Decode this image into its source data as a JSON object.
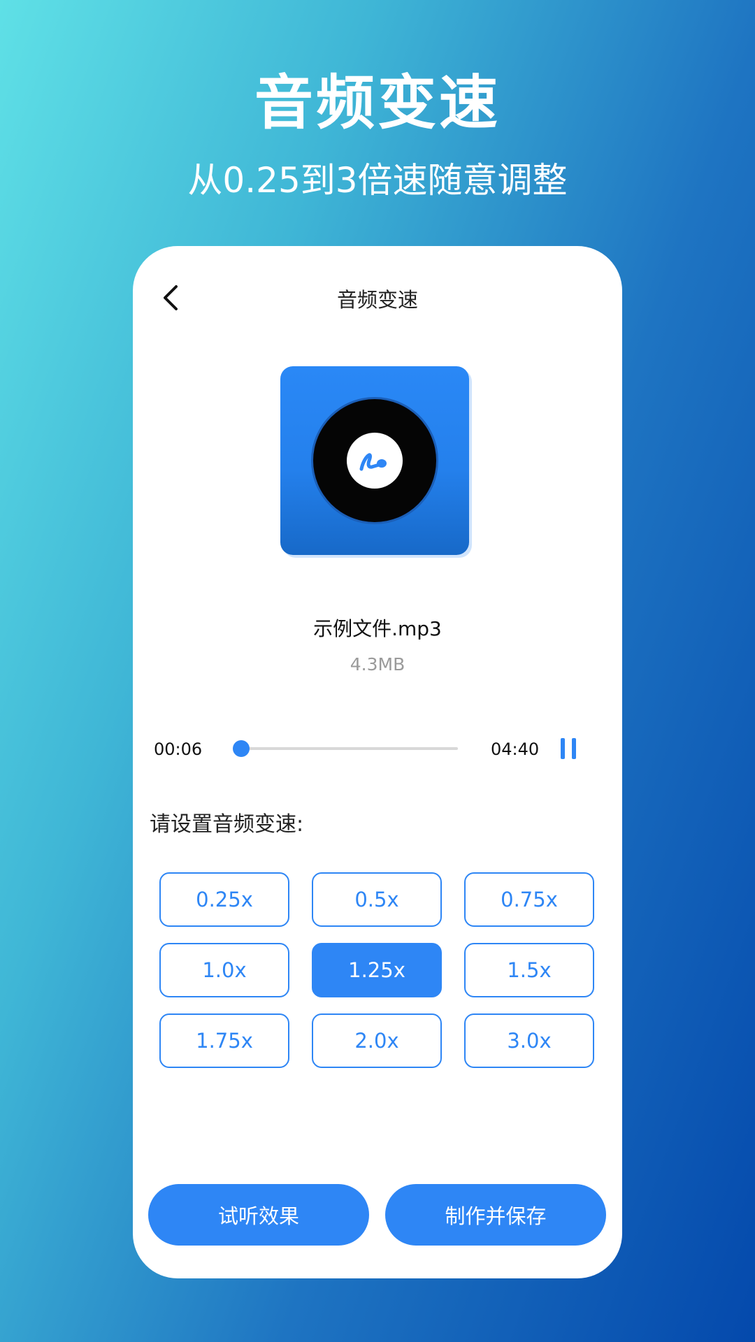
{
  "promo": {
    "title": "音频变速",
    "subtitle": "从0.25到3倍速随意调整"
  },
  "header": {
    "title": "音频变速",
    "back_icon": "chevron-left-icon"
  },
  "cover": {
    "icon": "music-disc-icon",
    "accent_color": "#2A88F6"
  },
  "file": {
    "name": "示例文件.mp3",
    "size": "4.3MB"
  },
  "player": {
    "current_time": "00:06",
    "total_time": "04:40",
    "progress": 0.02,
    "state_icon": "pause-icon"
  },
  "speed": {
    "label": "请设置音频变速:",
    "options": [
      "0.25x",
      "0.5x",
      "0.75x",
      "1.0x",
      "1.25x",
      "1.5x",
      "1.75x",
      "2.0x",
      "3.0x"
    ],
    "selected": "1.25x"
  },
  "actions": {
    "preview_label": "试听效果",
    "save_label": "制作并保存"
  },
  "colors": {
    "accent": "#2E86F5",
    "background_start": "#5FE0E6",
    "background_end": "#0449AC"
  }
}
